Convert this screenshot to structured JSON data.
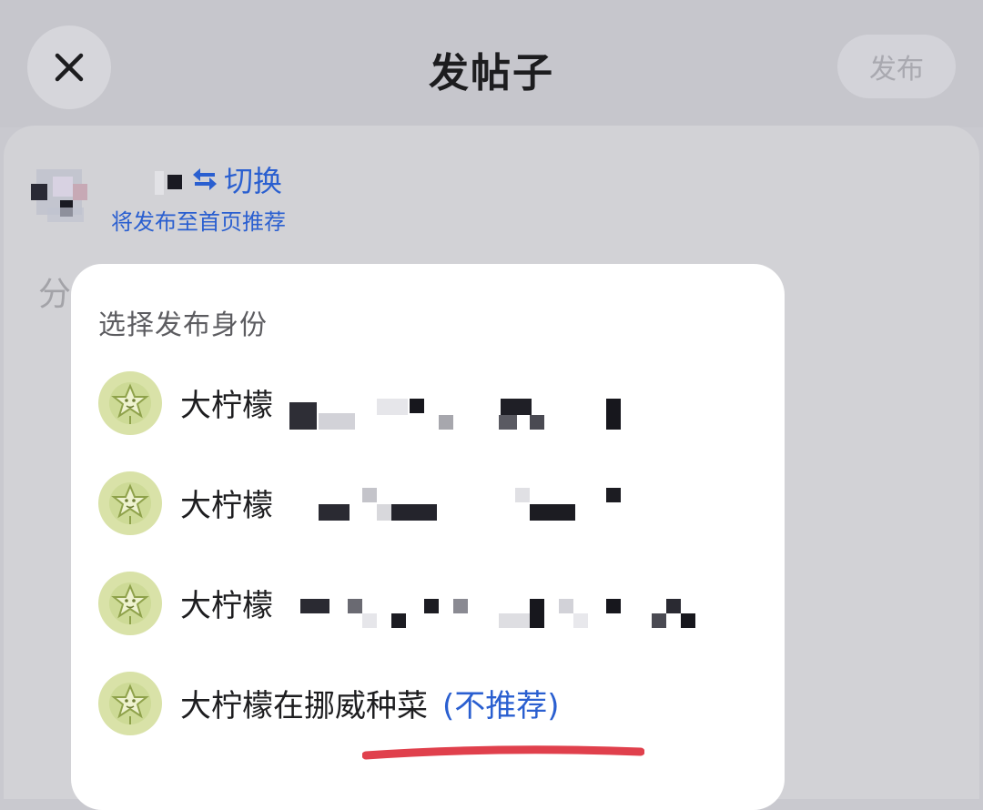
{
  "header": {
    "title": "发帖子",
    "publish_label": "发布",
    "close_icon": "close-icon"
  },
  "account": {
    "switch_label": "切换",
    "switch_icon": "swap-arrows-icon",
    "recommend_note": "将发布至首页推荐"
  },
  "composer": {
    "placeholder_peek": "分"
  },
  "identity_picker": {
    "title": "选择发布身份",
    "avatar_icon": "star-fruit-icon",
    "items": [
      {
        "name": "大柠檬",
        "suffix": ""
      },
      {
        "name": "大柠檬",
        "suffix": ""
      },
      {
        "name": "大柠檬",
        "suffix": ""
      },
      {
        "name": "大柠檬在挪威种菜",
        "suffix": "(不推荐)"
      }
    ]
  },
  "colors": {
    "accent": "#2a5fd0",
    "highlight_underline": "#e0404c",
    "avatar_bg": "#d9e2a8"
  }
}
